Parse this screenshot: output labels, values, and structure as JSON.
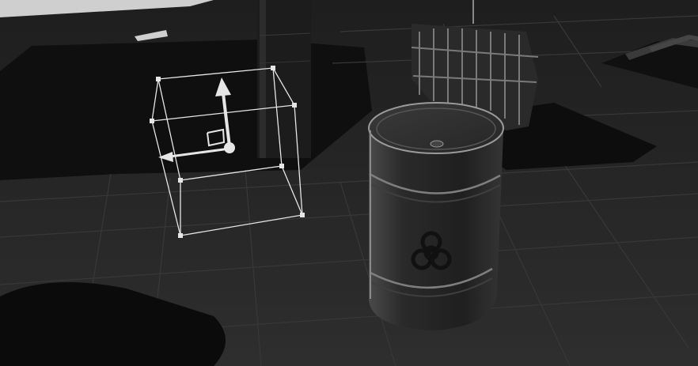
{
  "scene": {
    "view_mode": "shaded-grayscale",
    "objects": [
      {
        "name": "wall-pillar",
        "icon": "pillar-icon"
      },
      {
        "name": "barrel",
        "icon": "biohazard-icon"
      },
      {
        "name": "gate",
        "icon": "gate-icon"
      },
      {
        "name": "selection-bounds",
        "icon": "bounding-box-icon"
      }
    ]
  },
  "colors": {
    "floor": "#2a2a2a",
    "floor_dark": "#1b1b1b",
    "grid_line": "#3a3a3a",
    "shadow": "#0c0c0c",
    "gizmo": "#e6e6e6",
    "barrel_body": "#2b2b2b",
    "barrel_highlight": "#9a9a9a"
  },
  "gizmo": {
    "mode": "translate",
    "axis_icons": [
      "move-y-icon",
      "move-x-icon",
      "move-plane-icon"
    ]
  }
}
